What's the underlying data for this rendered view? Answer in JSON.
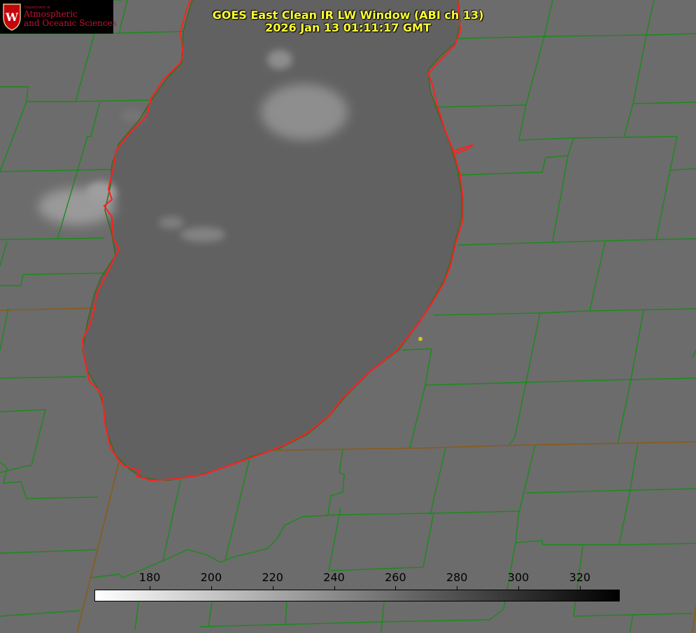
{
  "title": {
    "line1": "GOES East Clean IR LW Window (ABI ch 13)",
    "line2": "2026 Jan 13 01:11:17 GMT"
  },
  "logo": {
    "department": "Department of",
    "line1": "Atmospheric",
    "line2": "and Oceanic Sciences",
    "seal_letter": "W"
  },
  "colorbar": {
    "range": [
      162,
      333
    ],
    "ticks": [
      "180",
      "200",
      "220",
      "240",
      "260",
      "280",
      "300",
      "320"
    ],
    "tick_values": [
      180,
      200,
      220,
      240,
      260,
      280,
      300,
      320
    ],
    "colormap": [
      "#ffffff",
      "#000000"
    ]
  },
  "colors": {
    "background_land": "#6c6c6c",
    "lake": "#616161",
    "county_lines": "#1a8a1a",
    "state_lines": "#8a5a1a",
    "coastline": "#ff2020",
    "title": "#ffff33",
    "marker": "#d4c21a",
    "logo_text": "#c8102e"
  }
}
